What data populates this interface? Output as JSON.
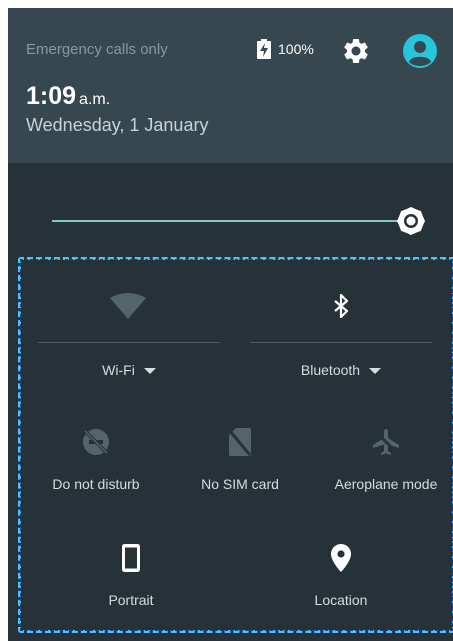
{
  "status": {
    "carrier_text": "Emergency calls only",
    "battery_percent": "100%",
    "battery_icon": "battery-charging-icon",
    "settings_icon": "gear-icon",
    "user_icon": "account-circle-icon"
  },
  "clock": {
    "time": "1:09",
    "suffix": "a.m.",
    "date": "Wednesday, 1 January"
  },
  "brightness": {
    "level": 1.0,
    "icon": "brightness-icon"
  },
  "tiles": [
    {
      "label": "Wi-Fi",
      "icon": "wifi-icon",
      "has_dropdown": true,
      "state": "disabled"
    },
    {
      "label": "Bluetooth",
      "icon": "bluetooth-icon",
      "has_dropdown": true,
      "state": "enabled"
    },
    {
      "label": "Do not disturb",
      "icon": "do-not-disturb-icon",
      "state": "disabled"
    },
    {
      "label": "No SIM card",
      "icon": "no-sim-icon",
      "state": "disabled"
    },
    {
      "label": "Aeroplane mode",
      "icon": "airplane-icon",
      "state": "disabled"
    },
    {
      "label": "Portrait",
      "icon": "phone-portrait-icon",
      "state": "enabled"
    },
    {
      "label": "Location",
      "icon": "location-pin-icon",
      "state": "enabled"
    }
  ],
  "colors": {
    "panel_background": "#263238",
    "header_background": "#37474f",
    "accent": "#80cbc4",
    "avatar": "#26c6da",
    "selection_outline": "#4fc3f7"
  }
}
